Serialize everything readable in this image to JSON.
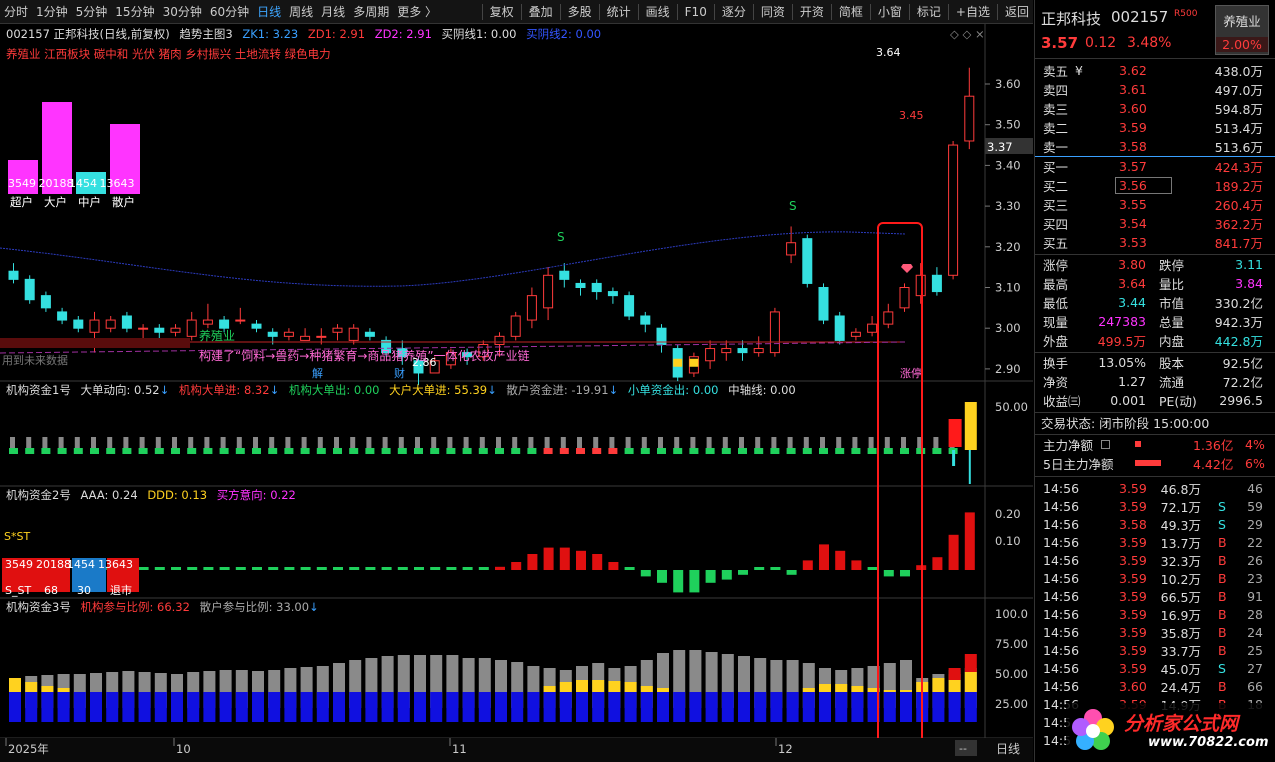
{
  "toolbar": {
    "items": [
      "分时",
      "1分钟",
      "5分钟",
      "15分钟",
      "30分钟",
      "60分钟",
      "日线",
      "周线",
      "月线",
      "多周期",
      "更多 〉"
    ],
    "right_items": [
      "复权",
      "叠加",
      "多股",
      "统计",
      "画线",
      "F10",
      "逐分",
      "同资",
      "开资",
      "简框",
      "小窗",
      "标记",
      "+自选",
      "返回"
    ]
  },
  "main": {
    "code_label": "002157 正邦科技(日线,前复权)",
    "indicator_name": "趋势主图3",
    "zk_label": "ZK1: 3.23",
    "zd1_label": "ZD1: 2.91",
    "zd2_label": "ZD2: 2.91",
    "buy_yin1": "买阴线1: 0.00",
    "buy_yin2": "买阴线2: 0.00",
    "concepts": "养殖业  江西板块  碳中和  光伏  猪肉  乡村振兴  土地流转  绿色电力",
    "bar_labels": [
      "3549",
      "20188",
      "1454",
      "13643"
    ],
    "bar_cats": [
      "超户",
      "大户",
      "中户",
      "散户"
    ],
    "price_ticks": [
      "3.60",
      "3.50",
      "3.40",
      "3.30",
      "3.20",
      "3.10",
      "3.00",
      "2.90"
    ],
    "cursor_price": "3.37",
    "peak_label": "3.64",
    "label_345": "3.45",
    "low_label": "2.86",
    "industry": "养殖业",
    "industry_desc": "构建了“饲料→兽药→种猪繁育→商品猪养殖”一体化农牧产业链",
    "future_label": "用到未来数据",
    "jie_label": "解",
    "cai_label": "财",
    "zhangting_label": "涨停",
    "s_marks": [
      "S",
      "S"
    ]
  },
  "panel1": {
    "title": "机构资金1号",
    "big_move": "大单动向: 0.52",
    "inst_in": "机构大单进: 8.32",
    "inst_out": "机构大单出: 0.00",
    "big_in": "大户大单进: 55.39",
    "retail_in": "散户资金进: -19.91",
    "small_out": "小单资金出: 0.00",
    "axis": "中轴线: 0.00",
    "tick": "50.00"
  },
  "panel2": {
    "title": "机构资金2号",
    "aaa": "AAA: 0.24",
    "ddd": "DDD: 0.13",
    "buy_dir": "买方意向: 0.22",
    "st": "S*ST",
    "box_labels": [
      "3549",
      "20188",
      "1454",
      "13643"
    ],
    "box_small": [
      "68",
      "30",
      "退市"
    ],
    "sst_label": "S_ST",
    "ticks": [
      "0.20",
      "0.10"
    ]
  },
  "panel3": {
    "title": "机构资金3号",
    "inst_ratio": "机构参与比例: 66.32",
    "retail_ratio": "散户参与比例: 33.00",
    "ticks": [
      "100.0",
      "75.00",
      "50.00",
      "25.00"
    ]
  },
  "xaxis": {
    "labels": [
      "2025年",
      "10",
      "11",
      "12"
    ],
    "period": "日线",
    "nav": "--"
  },
  "stock": {
    "name": "正邦科技",
    "code": "002157",
    "tag": "R500",
    "sector": "养殖业",
    "price": "3.57",
    "change": "0.12",
    "pct": "3.48%",
    "sector_pct": "2.00%"
  },
  "asks": [
    {
      "label": "卖五",
      "price": "3.62",
      "vol": "438.0万",
      "sym": "¥"
    },
    {
      "label": "卖四",
      "price": "3.61",
      "vol": "497.0万",
      "sym": ""
    },
    {
      "label": "卖三",
      "price": "3.60",
      "vol": "594.8万",
      "sym": ""
    },
    {
      "label": "卖二",
      "price": "3.59",
      "vol": "513.4万",
      "sym": ""
    },
    {
      "label": "卖一",
      "price": "3.58",
      "vol": "513.6万",
      "sym": ""
    }
  ],
  "bids": [
    {
      "label": "买一",
      "price": "3.57",
      "vol": "424.3万"
    },
    {
      "label": "买二",
      "price": "3.56",
      "vol": "189.2万"
    },
    {
      "label": "买三",
      "price": "3.55",
      "vol": "260.4万"
    },
    {
      "label": "买四",
      "price": "3.54",
      "vol": "362.2万"
    },
    {
      "label": "买五",
      "price": "3.53",
      "vol": "841.7万"
    }
  ],
  "stats": [
    {
      "l1": "涨停",
      "v1": "3.80",
      "l2": "跌停",
      "v2": "3.11"
    },
    {
      "l1": "最高",
      "v1": "3.64",
      "l2": "量比",
      "v2": "3.84"
    },
    {
      "l1": "最低",
      "v1": "3.44",
      "l2": "市值",
      "v2": "330.2亿"
    },
    {
      "l1": "现量",
      "v1": "247383",
      "l2": "总量",
      "v2": "942.3万"
    },
    {
      "l1": "外盘",
      "v1": "499.5万",
      "l2": "内盘",
      "v2": "442.8万"
    }
  ],
  "stats2": [
    {
      "l1": "换手",
      "v1": "13.05%",
      "l2": "股本",
      "v2": "92.5亿"
    },
    {
      "l1": "净资",
      "v1": "1.27",
      "l2": "流通",
      "v2": "72.2亿"
    },
    {
      "l1": "收益㈢",
      "v1": "0.001",
      "l2": "PE(动)",
      "v2": "2996.5"
    }
  ],
  "trade_status": "交易状态: 闭市阶段 15:00:00",
  "main_flow": {
    "label": "主力净额",
    "value": "1.36亿",
    "pct": "4%"
  },
  "flow5": {
    "label": "5日主力净额",
    "value": "4.42亿",
    "pct": "6%"
  },
  "ticks": [
    {
      "t": "14:56",
      "p": "3.59",
      "v": "46.8万",
      "s": "",
      "n": "46"
    },
    {
      "t": "14:56",
      "p": "3.59",
      "v": "72.1万",
      "s": "S",
      "n": "59"
    },
    {
      "t": "14:56",
      "p": "3.58",
      "v": "49.3万",
      "s": "S",
      "n": "29"
    },
    {
      "t": "14:56",
      "p": "3.59",
      "v": "13.7万",
      "s": "B",
      "n": "22"
    },
    {
      "t": "14:56",
      "p": "3.59",
      "v": "32.3万",
      "s": "B",
      "n": "26"
    },
    {
      "t": "14:56",
      "p": "3.59",
      "v": "10.2万",
      "s": "B",
      "n": "23"
    },
    {
      "t": "14:56",
      "p": "3.59",
      "v": "66.5万",
      "s": "B",
      "n": "91"
    },
    {
      "t": "14:56",
      "p": "3.59",
      "v": "16.9万",
      "s": "B",
      "n": "28"
    },
    {
      "t": "14:56",
      "p": "3.59",
      "v": "35.8万",
      "s": "B",
      "n": "24"
    },
    {
      "t": "14:56",
      "p": "3.59",
      "v": "33.7万",
      "s": "B",
      "n": "25"
    },
    {
      "t": "14:56",
      "p": "3.59",
      "v": "45.0万",
      "s": "S",
      "n": "27"
    },
    {
      "t": "14:56",
      "p": "3.60",
      "v": "24.4万",
      "s": "B",
      "n": "66"
    },
    {
      "t": "14:56",
      "p": "3.59",
      "v": "14.9万",
      "s": "B",
      "n": "18"
    },
    {
      "t": "14:5",
      "p": "",
      "v": "",
      "s": "",
      "n": ""
    },
    {
      "t": "14:5",
      "p": "",
      "v": "",
      "s": "",
      "n": ""
    }
  ],
  "watermark": {
    "text": "分析家公式网",
    "url": "www.70822.com"
  }
}
